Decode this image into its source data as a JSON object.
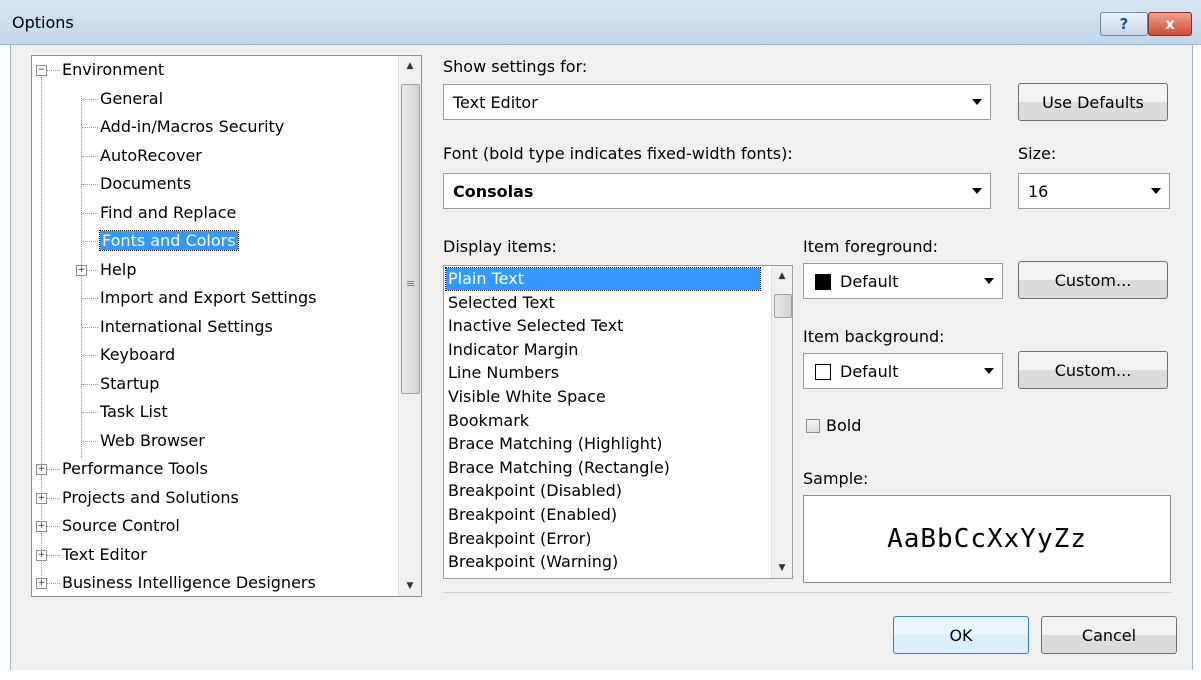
{
  "window": {
    "title": "Options",
    "help_label": "?",
    "close_label": "x"
  },
  "tree": {
    "items": [
      {
        "label": "Environment",
        "level": 0,
        "expander": "minus"
      },
      {
        "label": "General",
        "level": 1
      },
      {
        "label": "Add-in/Macros Security",
        "level": 1
      },
      {
        "label": "AutoRecover",
        "level": 1
      },
      {
        "label": "Documents",
        "level": 1
      },
      {
        "label": "Find and Replace",
        "level": 1
      },
      {
        "label": "Fonts and Colors",
        "level": 1,
        "selected": true
      },
      {
        "label": "Help",
        "level": 1,
        "expander": "plus"
      },
      {
        "label": "Import and Export Settings",
        "level": 1
      },
      {
        "label": "International Settings",
        "level": 1
      },
      {
        "label": "Keyboard",
        "level": 1
      },
      {
        "label": "Startup",
        "level": 1
      },
      {
        "label": "Task List",
        "level": 1
      },
      {
        "label": "Web Browser",
        "level": 1
      },
      {
        "label": "Performance Tools",
        "level": 0,
        "expander": "plus"
      },
      {
        "label": "Projects and Solutions",
        "level": 0,
        "expander": "plus"
      },
      {
        "label": "Source Control",
        "level": 0,
        "expander": "plus"
      },
      {
        "label": "Text Editor",
        "level": 0,
        "expander": "plus"
      },
      {
        "label": "Business Intelligence Designers",
        "level": 0,
        "expander": "plus"
      }
    ]
  },
  "settings": {
    "show_label": "Show settings for:",
    "show_value": "Text Editor",
    "use_defaults_label": "Use Defaults",
    "font_label": "Font (bold type indicates fixed-width fonts):",
    "font_value": "Consolas",
    "size_label": "Size:",
    "size_value": "16",
    "display_items_label": "Display items:",
    "display_items": [
      "Plain Text",
      "Selected Text",
      "Inactive Selected Text",
      "Indicator Margin",
      "Line Numbers",
      "Visible White Space",
      "Bookmark",
      "Brace Matching (Highlight)",
      "Brace Matching (Rectangle)",
      "Breakpoint (Disabled)",
      "Breakpoint (Enabled)",
      "Breakpoint (Error)",
      "Breakpoint (Warning)"
    ],
    "selected_item": "Plain Text",
    "fg_label": "Item foreground:",
    "fg_value": "Default",
    "fg_swatch_color": "#000000",
    "fg_custom_label": "Custom...",
    "bg_label": "Item background:",
    "bg_value": "Default",
    "bg_swatch_color": "#ffffff",
    "bg_custom_label": "Custom...",
    "bold_label": "Bold",
    "bold_checked": false,
    "sample_label": "Sample:",
    "sample_text": "AaBbCcXxYyZz"
  },
  "footer": {
    "ok_label": "OK",
    "cancel_label": "Cancel"
  },
  "colors": {
    "selection": "#3399ff",
    "titlebar": "#c9dcee",
    "dialog_bg": "#f0f0f0"
  }
}
